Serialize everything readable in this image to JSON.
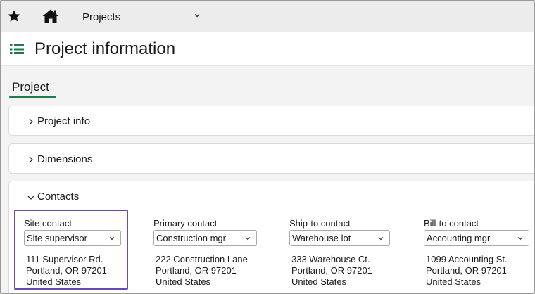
{
  "nav": {
    "title": "Projects",
    "icons": {
      "favorite": "star-icon",
      "home": "home-icon",
      "dropdown": "chevron-down-icon"
    }
  },
  "header": {
    "title": "Project information",
    "icon": "list-icon"
  },
  "tabs": [
    {
      "label": "Project",
      "active": true
    }
  ],
  "sections": [
    {
      "label": "Project info",
      "expanded": false
    },
    {
      "label": "Dimensions",
      "expanded": false
    },
    {
      "label": "Contacts",
      "expanded": true
    }
  ],
  "contacts": [
    {
      "label": "Site contact",
      "value": "Site supervisor",
      "address": [
        "111 Supervisor Rd.",
        "Portland, OR 97201",
        "United States"
      ]
    },
    {
      "label": "Primary contact",
      "value": "Construction mgr",
      "address": [
        "222 Construction Lane",
        "Portland, OR 97201",
        "United States"
      ]
    },
    {
      "label": "Ship-to contact",
      "value": "Warehouse lot",
      "address": [
        "333 Warehouse Ct.",
        "Portland, OR 97201",
        "United States"
      ]
    },
    {
      "label": "Bill-to contact",
      "value": "Accounting mgr",
      "address": [
        "1099 Accounting St.",
        "Portland, OR 97201",
        "United States"
      ]
    }
  ],
  "colors": {
    "accent_green": "#1d7a4a",
    "highlight_purple": "#6b4bb3",
    "topbar_bg": "#ececec",
    "content_bg": "#f3f3f3"
  }
}
